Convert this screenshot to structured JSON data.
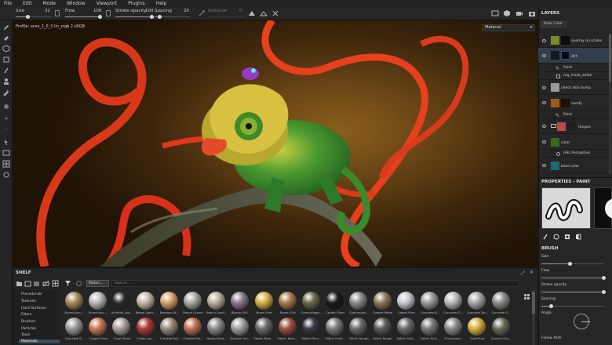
{
  "menu": [
    "File",
    "Edit",
    "Mode",
    "Window",
    "Viewport",
    "Plugins",
    "Help"
  ],
  "toolbar": {
    "size_label": "Size",
    "size_value": "32",
    "flow_label": "Flow",
    "flow_value": "100",
    "stroke_opacity_label": "Stroke opacity",
    "stroke_opacity_value": "100",
    "spacing_label": "Spacing",
    "spacing_value": "20",
    "distance_label": "Distance",
    "distance_value": "0"
  },
  "viewport": {
    "profile_text": "Profile: aces_1_0_3 lin_srgb 2 sRGB",
    "display_mode": "Material"
  },
  "layers": {
    "title": "LAYERS",
    "channel": "Base Color",
    "items": [
      {
        "name": "overlay on scales",
        "thumb": "#7b8a2a",
        "thumb2": "#0c0c10"
      },
      {
        "name": "dirt",
        "thumb": "#15161a",
        "thumb2": "#0c0c10"
      },
      {
        "name": "Paint",
        "sub": true
      },
      {
        "name": "mg_mask_editor",
        "sub": true
      },
      {
        "name": "check skin bump",
        "thumb": "#9b9b9b"
      },
      {
        "name": "comfy",
        "thumb": "#a05a1f",
        "thumb2": "#1a1208"
      },
      {
        "name": "Paint",
        "sub": true
      },
      {
        "name": "tongue",
        "thumb": "#b84a4a",
        "thumb2": "#202020"
      },
      {
        "name": "color",
        "thumb": "#3a6a1e"
      },
      {
        "name": "HSL Perceptive",
        "sub": true
      },
      {
        "name": "base color",
        "thumb": "#1a6a6e"
      }
    ]
  },
  "properties": {
    "title": "PROPERTIES - PAINT",
    "brush_title": "BRUSH",
    "size_label": "Size",
    "size_fraction": 0.45,
    "flow_label": "Flow",
    "flow_fraction": 1.0,
    "stroke_opacity_label": "Stroke opacity",
    "stroke_opacity_fraction": 1.0,
    "spacing_label": "Spacing",
    "spacing_fraction": 0.15,
    "angle_label": "Angle",
    "follow_path_label": "Follow Path"
  },
  "shelf": {
    "title": "SHELF",
    "filter": "Materi...",
    "search_placeholder": "Search...",
    "categories": [
      "Procedurals",
      "Textures",
      "Hard Surfaces",
      "Filters",
      "Brushes",
      "Particles",
      "Tools",
      "Materials"
    ],
    "selected_category": "Materials",
    "materials_row1": [
      {
        "name": "Aluminium ...",
        "color": "#a78a5a"
      },
      {
        "name": "Aluminium ...",
        "color": "#b8b8b8"
      },
      {
        "name": "Artificial Lea...",
        "color": "#2a2a2a"
      },
      {
        "name": "Baked Light...",
        "color": "#c8b8a8"
      },
      {
        "name": "Bamboo W...",
        "color": "#d8a068"
      },
      {
        "name": "Beach Gravel",
        "color": "#a8a8a0"
      },
      {
        "name": "Beach Sand...",
        "color": "#b8b0a0"
      },
      {
        "name": "Blocky Olif...",
        "color": "#8a7a8a"
      },
      {
        "name": "Brass Pure",
        "color": "#d8b048"
      },
      {
        "name": "Brown Dirt",
        "color": "#a87a48"
      },
      {
        "name": "Camouflage...",
        "color": "#6a6a4a"
      },
      {
        "name": "Carbon Fiber",
        "color": "#1a1a1a"
      },
      {
        "name": "Chainmaile...",
        "color": "#8a8a8a"
      },
      {
        "name": "Coated Metal",
        "color": "#8a7a5a"
      },
      {
        "name": "Cobalt Pure",
        "color": "#c8c8d0"
      },
      {
        "name": "Concrete B...",
        "color": "#9a9a9a"
      },
      {
        "name": "Concrete Cl...",
        "color": "#b8b8b8"
      },
      {
        "name": "Concrete Do...",
        "color": "#a8a8a8"
      },
      {
        "name": "Concrete S...",
        "color": "#8a8a88"
      }
    ],
    "materials_row2": [
      {
        "name": "Concrete S...",
        "color": "#9a9a98"
      },
      {
        "name": "Copper Pure",
        "color": "#c87a58"
      },
      {
        "name": "Coral Stone",
        "color": "#a8a098"
      },
      {
        "name": "Cotton wa...",
        "color": "#b03a3a"
      },
      {
        "name": "Cracked Soil",
        "color": "#9a8a78"
      },
      {
        "name": "Crashed Ro...",
        "color": "#c07050"
      },
      {
        "name": "Damp Sand...",
        "color": "#8a8a88"
      },
      {
        "name": "Dented Con...",
        "color": "#a0a0a0"
      },
      {
        "name": "Fabric Bam...",
        "color": "#6a6a6a"
      },
      {
        "name": "Fabric Base...",
        "color": "#9a5040"
      },
      {
        "name": "Fabric Deni...",
        "color": "#3a3a48"
      },
      {
        "name": "Fabric Knitt...",
        "color": "#7a7a7a"
      },
      {
        "name": "Fabric Rough",
        "color": "#6a6a6a"
      },
      {
        "name": "Fabric Rough",
        "color": "#5a5a5a"
      },
      {
        "name": "Fabric Soft...",
        "color": "#6a6a6a"
      },
      {
        "name": "Fabric Suit...",
        "color": "#7a7a7a"
      },
      {
        "name": "Fine Jersey...",
        "color": "#8a8a8a"
      },
      {
        "name": "Gold Pure",
        "color": "#d8b040"
      },
      {
        "name": "Ground Gra...",
        "color": "#6a6a5a"
      }
    ]
  }
}
